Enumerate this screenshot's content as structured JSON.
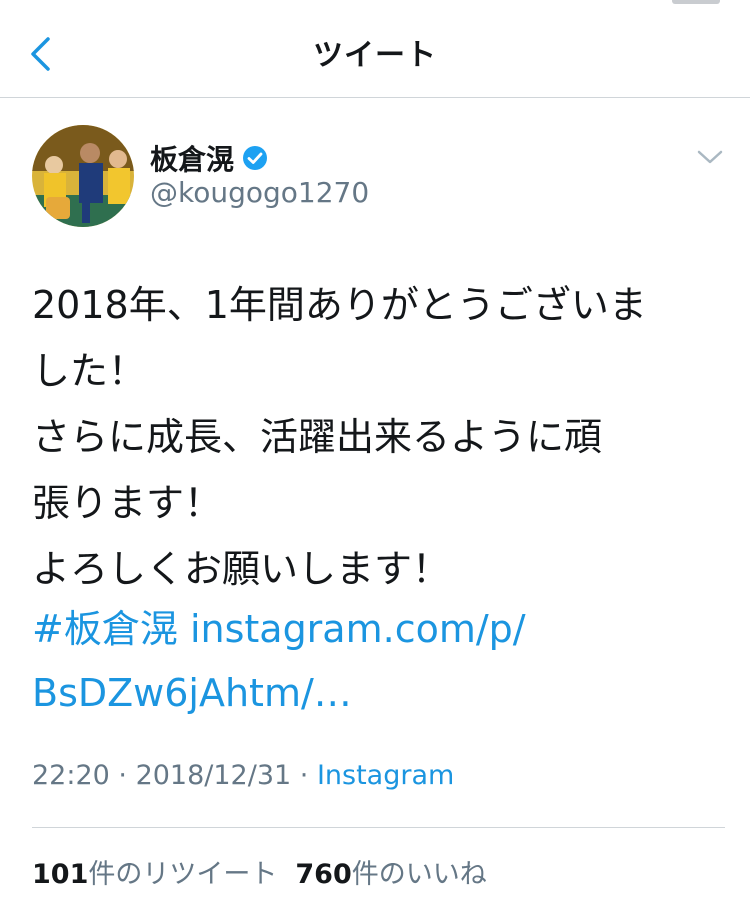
{
  "nav": {
    "title": "ツイート"
  },
  "author": {
    "name": "板倉滉",
    "handle": "@kougogo1270"
  },
  "tweet": {
    "lines": [
      "2018年、1年間ありがとうございま",
      "した！",
      "さらに成長、活躍出来るように頑",
      "張ります！",
      "よろしくお願いします！"
    ],
    "link_line_1_hashtag": "#板倉滉",
    "link_line_1_url": "instagram.com/p/",
    "link_line_2": "BsDZw6jAhtm/…"
  },
  "meta": {
    "time": "22:20",
    "sep1": " · ",
    "date": "2018/12/31",
    "sep2": " · ",
    "source": "Instagram"
  },
  "stats": {
    "retweets_count": "101",
    "retweets_label": "件のリツイート",
    "likes_count": "760",
    "likes_label": "件のいいね"
  },
  "colors": {
    "link": "#1b95e0",
    "muted": "#657786",
    "text": "#14171a",
    "verified": "#1da1f2"
  }
}
